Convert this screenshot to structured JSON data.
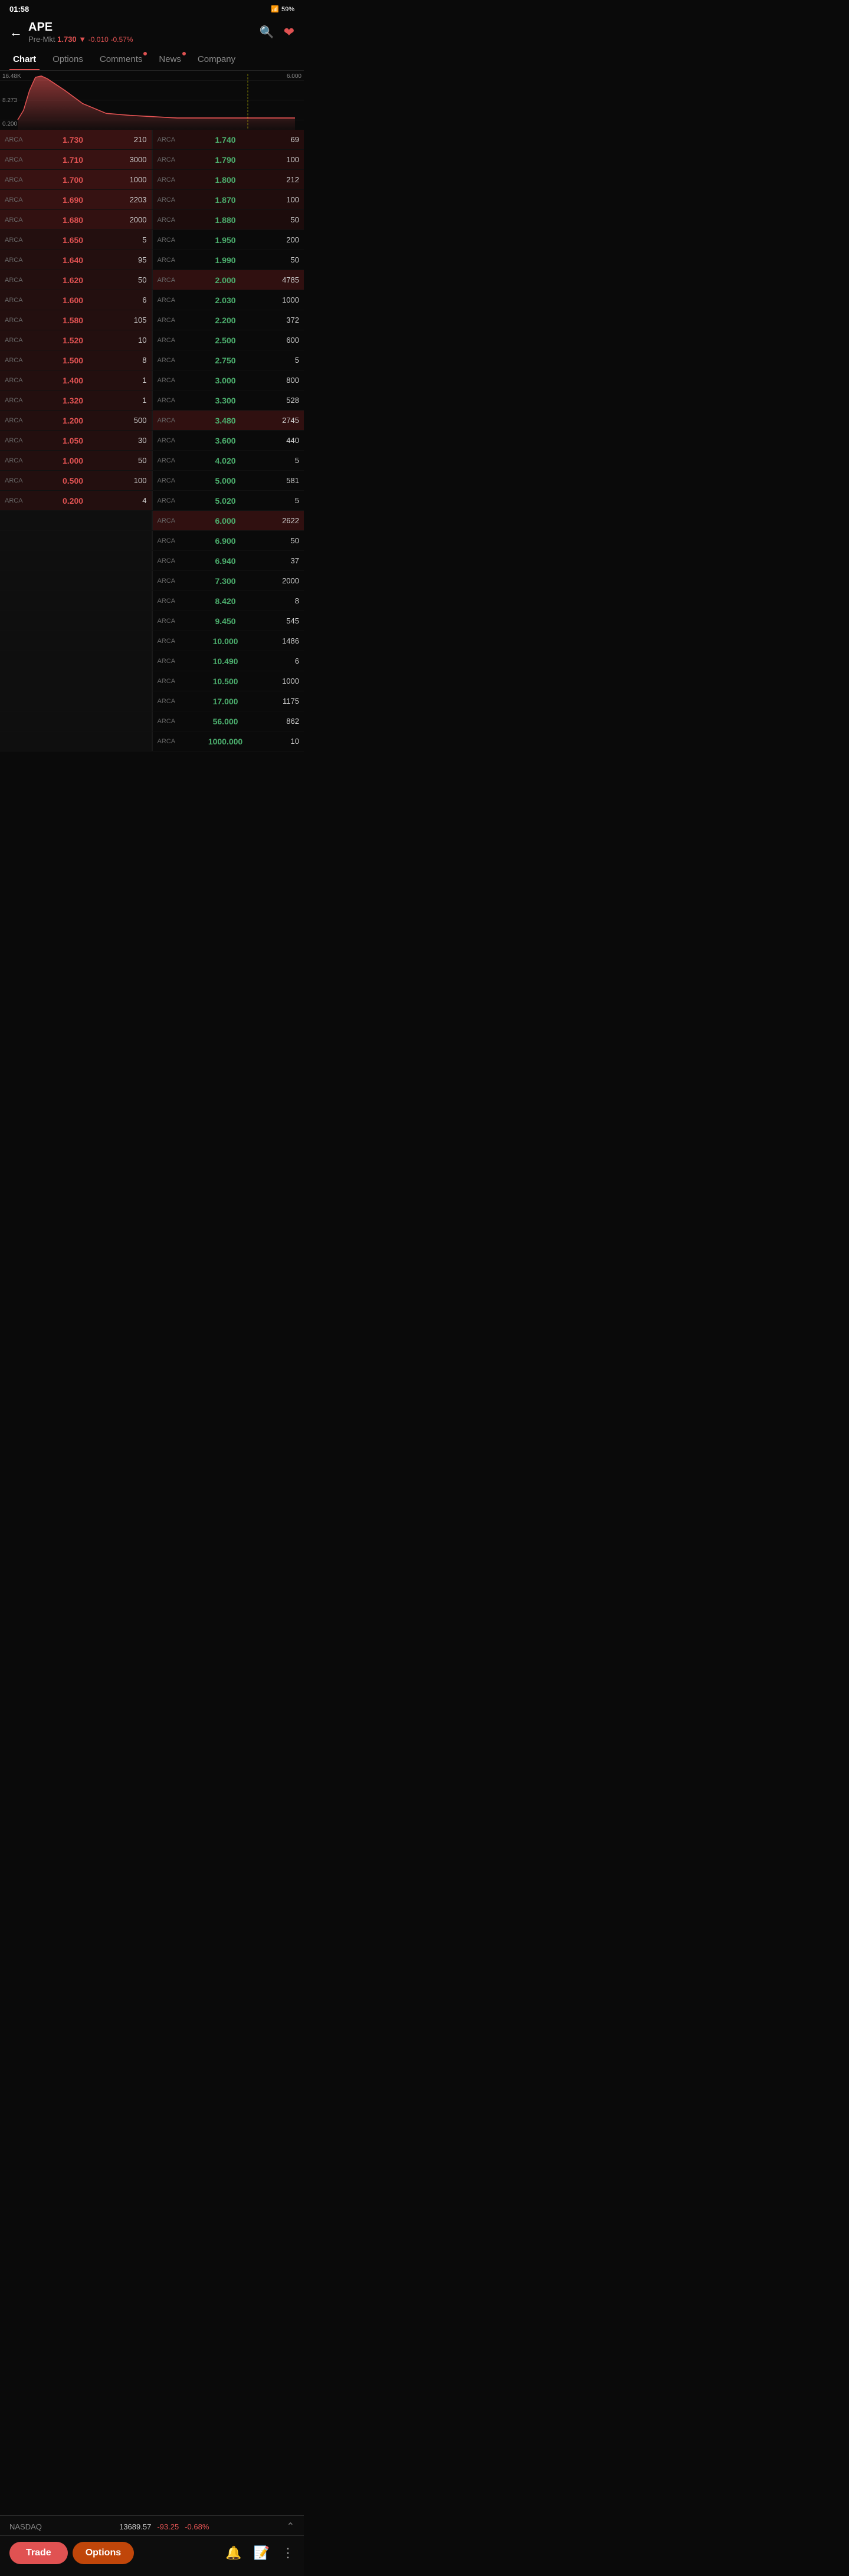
{
  "statusBar": {
    "time": "01:58",
    "battery": "59%"
  },
  "header": {
    "ticker": "APE",
    "preMarketLabel": "Pre-Mkt",
    "price": "1.730",
    "change": "-0.010",
    "changePct": "-0.57%"
  },
  "tabs": [
    {
      "id": "chart",
      "label": "Chart",
      "active": true,
      "dot": false
    },
    {
      "id": "options",
      "label": "Options",
      "active": false,
      "dot": false
    },
    {
      "id": "comments",
      "label": "Comments",
      "active": false,
      "dot": true
    },
    {
      "id": "news",
      "label": "News",
      "active": false,
      "dot": true
    },
    {
      "id": "company",
      "label": "Company",
      "active": false,
      "dot": false
    }
  ],
  "chart": {
    "high": "16.48K",
    "mid": "8.273",
    "low": "0.200",
    "rightHigh": "6.000"
  },
  "orderbook": {
    "bids": [
      {
        "exchange": "ARCA",
        "price": "1.730",
        "size": "210"
      },
      {
        "exchange": "ARCA",
        "price": "1.710",
        "size": "3000"
      },
      {
        "exchange": "ARCA",
        "price": "1.700",
        "size": "1000"
      },
      {
        "exchange": "ARCA",
        "price": "1.690",
        "size": "2203"
      },
      {
        "exchange": "ARCA",
        "price": "1.680",
        "size": "2000"
      },
      {
        "exchange": "ARCA",
        "price": "1.650",
        "size": "5"
      },
      {
        "exchange": "ARCA",
        "price": "1.640",
        "size": "95"
      },
      {
        "exchange": "ARCA",
        "price": "1.620",
        "size": "50"
      },
      {
        "exchange": "ARCA",
        "price": "1.600",
        "size": "6"
      },
      {
        "exchange": "ARCA",
        "price": "1.580",
        "size": "105"
      },
      {
        "exchange": "ARCA",
        "price": "1.520",
        "size": "10"
      },
      {
        "exchange": "ARCA",
        "price": "1.500",
        "size": "8"
      },
      {
        "exchange": "ARCA",
        "price": "1.400",
        "size": "1"
      },
      {
        "exchange": "ARCA",
        "price": "1.320",
        "size": "1"
      },
      {
        "exchange": "ARCA",
        "price": "1.200",
        "size": "500"
      },
      {
        "exchange": "ARCA",
        "price": "1.050",
        "size": "30"
      },
      {
        "exchange": "ARCA",
        "price": "1.000",
        "size": "50"
      },
      {
        "exchange": "ARCA",
        "price": "0.500",
        "size": "100"
      },
      {
        "exchange": "ARCA",
        "price": "0.200",
        "size": "4"
      }
    ],
    "asks": [
      {
        "exchange": "ARCA",
        "price": "1.740",
        "size": "69"
      },
      {
        "exchange": "ARCA",
        "price": "1.790",
        "size": "100"
      },
      {
        "exchange": "ARCA",
        "price": "1.800",
        "size": "212"
      },
      {
        "exchange": "ARCA",
        "price": "1.870",
        "size": "100"
      },
      {
        "exchange": "ARCA",
        "price": "1.880",
        "size": "50"
      },
      {
        "exchange": "ARCA",
        "price": "1.950",
        "size": "200"
      },
      {
        "exchange": "ARCA",
        "price": "1.990",
        "size": "50"
      },
      {
        "exchange": "ARCA",
        "price": "2.000",
        "size": "4785"
      },
      {
        "exchange": "ARCA",
        "price": "2.030",
        "size": "1000"
      },
      {
        "exchange": "ARCA",
        "price": "2.200",
        "size": "372"
      },
      {
        "exchange": "ARCA",
        "price": "2.500",
        "size": "600"
      },
      {
        "exchange": "ARCA",
        "price": "2.750",
        "size": "5"
      },
      {
        "exchange": "ARCA",
        "price": "3.000",
        "size": "800"
      },
      {
        "exchange": "ARCA",
        "price": "3.300",
        "size": "528"
      },
      {
        "exchange": "ARCA",
        "price": "3.480",
        "size": "2745"
      },
      {
        "exchange": "ARCA",
        "price": "3.600",
        "size": "440"
      },
      {
        "exchange": "ARCA",
        "price": "4.020",
        "size": "5"
      },
      {
        "exchange": "ARCA",
        "price": "5.000",
        "size": "581"
      },
      {
        "exchange": "ARCA",
        "price": "5.020",
        "size": "5"
      },
      {
        "exchange": "ARCA",
        "price": "6.000",
        "size": "2622"
      },
      {
        "exchange": "ARCA",
        "price": "6.900",
        "size": "50"
      },
      {
        "exchange": "ARCA",
        "price": "6.940",
        "size": "37"
      },
      {
        "exchange": "ARCA",
        "price": "7.300",
        "size": "2000"
      },
      {
        "exchange": "ARCA",
        "price": "8.420",
        "size": "8"
      },
      {
        "exchange": "ARCA",
        "price": "9.450",
        "size": "545"
      },
      {
        "exchange": "ARCA",
        "price": "10.000",
        "size": "1486"
      },
      {
        "exchange": "ARCA",
        "price": "10.490",
        "size": "6"
      },
      {
        "exchange": "ARCA",
        "price": "10.500",
        "size": "1000"
      },
      {
        "exchange": "ARCA",
        "price": "17.000",
        "size": "1175"
      },
      {
        "exchange": "ARCA",
        "price": "56.000",
        "size": "862"
      },
      {
        "exchange": "ARCA",
        "price": "1000.000",
        "size": "10"
      }
    ]
  },
  "nasdaq": {
    "label": "NASDAQ",
    "price": "13689.57",
    "change": "-93.25",
    "changePct": "-0.68%"
  },
  "bottomBar": {
    "tradeLabel": "Trade",
    "optionsLabel": "Options"
  }
}
